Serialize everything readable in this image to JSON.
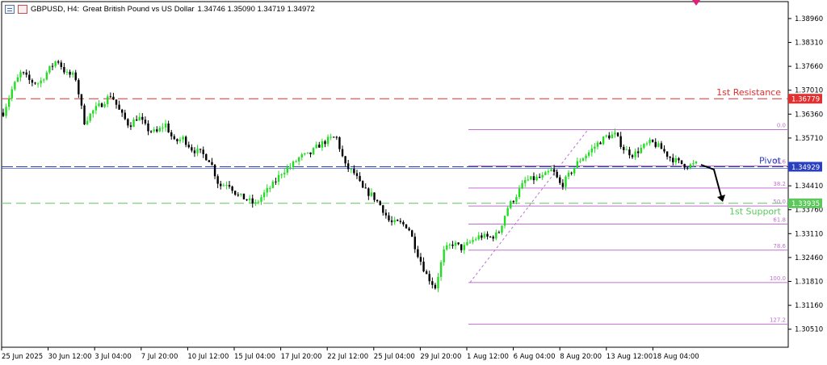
{
  "header": {
    "symbol": "GBPUSD, H4:",
    "description": "Great British Pound vs US Dollar",
    "ohlc": "1.34746 1.35090 1.34719 1.34972",
    "icons": [
      "chart-window-icon",
      "chart-tile-icon"
    ]
  },
  "chart_data": {
    "type": "candlestick",
    "title": "GBPUSD, H4",
    "ylim": [
      1.3002,
      1.3942
    ],
    "y_ticks": [
      "1.38960",
      "1.38310",
      "1.37660",
      "1.37010",
      "1.36360",
      "1.35710",
      "1.34410",
      "1.33760",
      "1.33110",
      "1.32460",
      "1.31810",
      "1.31160",
      "1.30510"
    ],
    "x_ticks": [
      "25 Jun 2025",
      "30 Jun 12:00",
      "3 Jul 04:00",
      "7 Jul 20:00",
      "10 Jul 12:00",
      "15 Jul 04:00",
      "17 Jul 20:00",
      "22 Jul 12:00",
      "25 Jul 04:00",
      "29 Jul 20:00",
      "1 Aug 12:00",
      "6 Aug 04:00",
      "8 Aug 20:00",
      "13 Aug 12:00",
      "18 Aug 04:00"
    ],
    "price_path": [
      1.364,
      1.3705,
      1.375,
      1.3725,
      1.372,
      1.3755,
      1.3785,
      1.3745,
      1.374,
      1.3615,
      1.3645,
      1.3665,
      1.369,
      1.364,
      1.3605,
      1.363,
      1.3595,
      1.3585,
      1.361,
      1.356,
      1.357,
      1.354,
      1.353,
      1.351,
      1.344,
      1.345,
      1.3415,
      1.3405,
      1.339,
      1.342,
      1.3445,
      1.348,
      1.3495,
      1.352,
      1.3525,
      1.355,
      1.3565,
      1.3575,
      1.3495,
      1.3475,
      1.343,
      1.3415,
      1.3385,
      1.334,
      1.334,
      1.333,
      1.326,
      1.32,
      1.3165,
      1.3265,
      1.3285,
      1.327,
      1.329,
      1.3305,
      1.33,
      1.331,
      1.338,
      1.3415,
      1.3455,
      1.346,
      1.3465,
      1.3485,
      1.344,
      1.3475,
      1.351,
      1.353,
      1.3555,
      1.3575,
      1.358,
      1.354,
      1.3525,
      1.3545,
      1.356,
      1.3545,
      1.352,
      1.3505,
      1.3495,
      1.35
    ],
    "levels": {
      "resistance": {
        "label": "1st Resistance",
        "price": 1.36779,
        "price_label": "1.36779",
        "color": "#e03030"
      },
      "pivot": {
        "label": "Pivot",
        "price": 1.34929,
        "price_label": "1.34929",
        "color": "#2a3fc0"
      },
      "support": {
        "label": "1st Support",
        "price": 1.33935,
        "price_label": "1.33935",
        "color": "#5cc85c"
      }
    },
    "fibonacci": [
      {
        "level": "0.0",
        "price": 1.3594
      },
      {
        "level": "23.6",
        "price": 1.3495
      },
      {
        "level": "38.2",
        "price": 1.3435
      },
      {
        "level": "50.0",
        "price": 1.3386
      },
      {
        "level": "61.8",
        "price": 1.3337
      },
      {
        "level": "78.6",
        "price": 1.3266
      },
      {
        "level": "100.0",
        "price": 1.3178
      },
      {
        "level": "127.2",
        "price": 1.3065
      }
    ],
    "fib_color": "#c070d0",
    "bull_color": "#22dd22",
    "bear_color": "#000000",
    "grid": false
  }
}
